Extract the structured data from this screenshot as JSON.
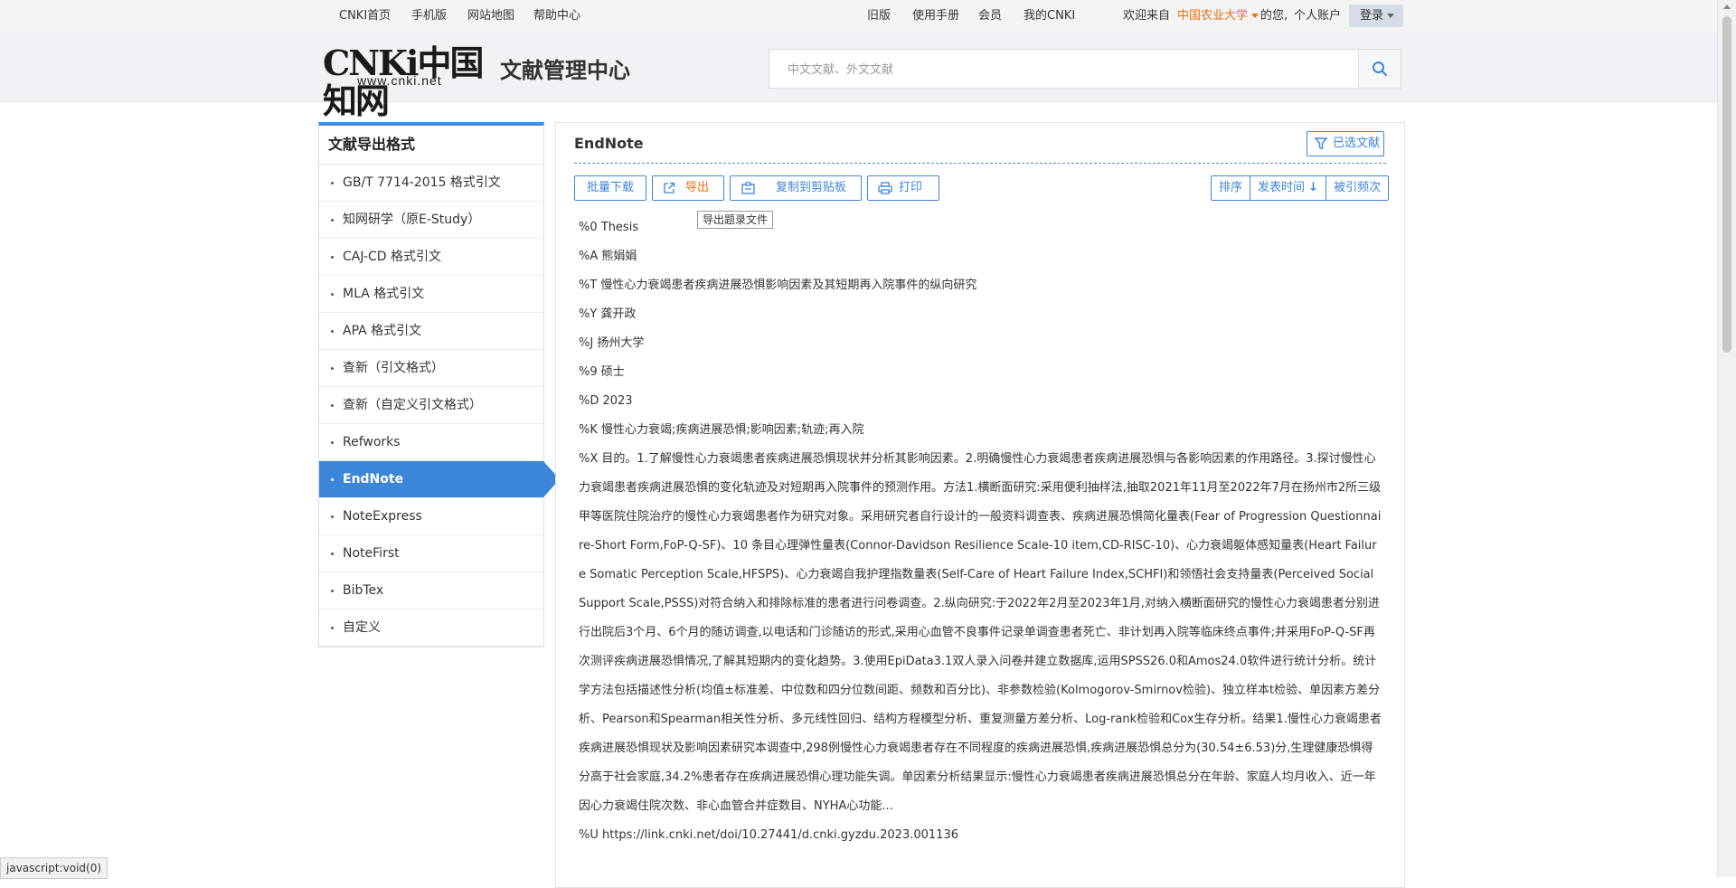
{
  "topbar": {
    "left": [
      "CNKI首页",
      "手机版",
      "网站地图",
      "帮助中心"
    ],
    "right": [
      "旧版",
      "使用手册",
      "会员",
      "我的CNKI"
    ],
    "welcome": "欢迎来自",
    "school": "中国农业大学",
    "greeting": "的您,",
    "account": "个人账户",
    "login": "登录"
  },
  "header": {
    "logo_text": "CNKi中国知网",
    "logo_url": "www.cnki.net",
    "title": "文献管理中心",
    "search_placeholder": "中文文献、外文文献",
    "icons": {
      "search": "search-icon"
    }
  },
  "sidebar": {
    "title": "文献导出格式",
    "items": [
      {
        "label": "GB/T 7714-2015 格式引文"
      },
      {
        "label": "知网研学（原E-Study）"
      },
      {
        "label": "CAJ-CD 格式引文"
      },
      {
        "label": "MLA 格式引文"
      },
      {
        "label": "APA 格式引文"
      },
      {
        "label": "查新（引文格式）"
      },
      {
        "label": "查新（自定义引文格式）"
      },
      {
        "label": "Refworks"
      },
      {
        "label": "EndNote",
        "active": true
      },
      {
        "label": "NoteExpress"
      },
      {
        "label": "NoteFirst"
      },
      {
        "label": "BibTex"
      },
      {
        "label": "自定义"
      }
    ]
  },
  "content": {
    "title": "EndNote",
    "selected_btn": "已选文献",
    "toolbar": {
      "batch_download": "批量下载",
      "export": "导出",
      "copy": "复制到剪贴板",
      "print": "打印"
    },
    "tooltip": "导出题录文件",
    "sort": {
      "label": "排序",
      "by_date": "发表时间",
      "by_cited": "被引频次"
    },
    "record": {
      "lines": [
        "%0 Thesis",
        "%A 熊娟娟",
        "%T 慢性心力衰竭患者疾病进展恐惧影响因素及其短期再入院事件的纵向研究",
        "%Y 龚开政",
        "%J 扬州大学",
        "%9 硕士",
        "%D 2023",
        "%K 慢性心力衰竭;疾病进展恐惧;影响因素;轨迹;再入院"
      ],
      "abstract": "%X 目的。1.了解慢性心力衰竭患者疾病进展恐惧现状并分析其影响因素。2.明确慢性心力衰竭患者疾病进展恐惧与各影响因素的作用路径。3.探讨慢性心力衰竭患者疾病进展恐惧的变化轨迹及对短期再入院事件的预测作用。方法1.横断面研究:采用便利抽样法,抽取2021年11月至2022年7月在扬州市2所三级甲等医院住院治疗的慢性心力衰竭患者作为研究对象。采用研究者自行设计的一般资料调查表、疾病进展恐惧简化量表(Fear of Progression Questionnaire-Short Form,FoP-Q-SF)、10 条目心理弹性量表(Connor-Davidson Resilience Scale-10 item,CD-RISC-10)、心力衰竭躯体感知量表(Heart Failure Somatic Perception Scale,HFSPS)、心力衰竭自我护理指数量表(Self-Care of Heart Failure Index,SCHFI)和领悟社会支持量表(Perceived Social Support Scale,PSSS)对符合纳入和排除标准的患者进行问卷调查。2.纵向研究:于2022年2月至2023年1月,对纳入横断面研究的慢性心力衰竭患者分别进行出院后3个月、6个月的随访调查,以电话和门诊随访的形式,采用心血管不良事件记录单调查患者死亡、非计划再入院等临床终点事件;并采用FoP-Q-SF再次测评疾病进展恐惧情况,了解其短期内的变化趋势。3.使用EpiData3.1双人录入问卷并建立数据库,运用SPSS26.0和Amos24.0软件进行统计分析。统计学方法包括描述性分析(均值±标准差、中位数和四分位数间距、频数和百分比)、非参数检验(Kolmogorov-Smirnov检验)、独立样本t检验、单因素方差分析、Pearson和Spearman相关性分析、多元线性回归、结构方程模型分析、重复测量方差分析、Log-rank检验和Cox生存分析。结果1.慢性心力衰竭患者疾病进展恐惧现状及影响因素研究本调查中,298例慢性心力衰竭患者存在不同程度的疾病进展恐惧,疾病进展恐惧总分为(30.54±6.53)分,生理健康恐惧得分高于社会家庭,34.2%患者存在疾病进展恐惧心理功能失调。单因素分析结果显示:慢性心力衰竭患者疾病进展恐惧总分在年龄、家庭人均月收入、近一年因心力衰竭住院次数、非心血管合并症数目、NYHA心功能...",
      "url": "%U https://link.cnki.net/doi/10.27441/d.cnki.gyzdu.2023.001136"
    }
  },
  "statusbar": "javascript:void(0)"
}
